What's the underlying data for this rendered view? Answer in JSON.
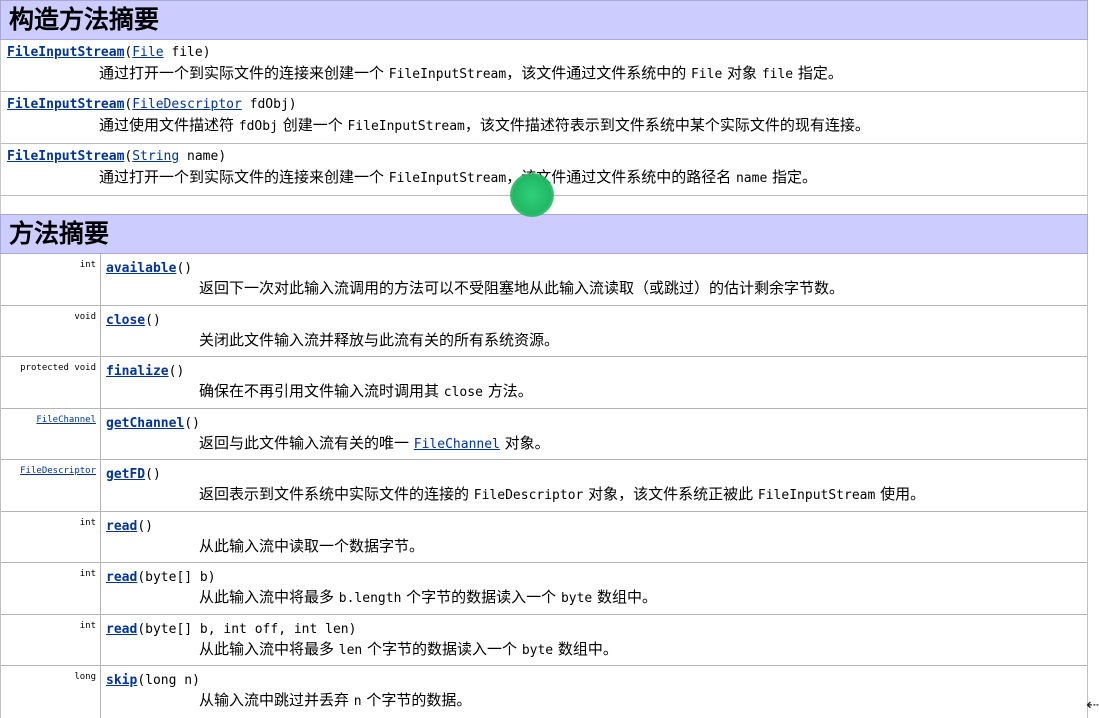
{
  "constructor_section": {
    "title": "构造方法摘要",
    "rows": [
      {
        "name": "FileInputStream",
        "param_type": "File",
        "param_name": "file",
        "desc": [
          {
            "t": "text",
            "v": "通过打开一个到实际文件的连接来创建一个 "
          },
          {
            "t": "mono",
            "v": "FileInputStream"
          },
          {
            "t": "text",
            "v": "，该文件通过文件系统中的 "
          },
          {
            "t": "mono",
            "v": "File"
          },
          {
            "t": "text",
            "v": " 对象 "
          },
          {
            "t": "mono",
            "v": "file"
          },
          {
            "t": "text",
            "v": " 指定。"
          }
        ]
      },
      {
        "name": "FileInputStream",
        "param_type": "FileDescriptor",
        "param_name": "fdObj",
        "desc": [
          {
            "t": "text",
            "v": "通过使用文件描述符 "
          },
          {
            "t": "mono",
            "v": "fdObj"
          },
          {
            "t": "text",
            "v": " 创建一个 "
          },
          {
            "t": "mono",
            "v": "FileInputStream"
          },
          {
            "t": "text",
            "v": "，该文件描述符表示到文件系统中某个实际文件的现有连接。"
          }
        ]
      },
      {
        "name": "FileInputStream",
        "param_type": "String",
        "param_name": "name",
        "desc": [
          {
            "t": "text",
            "v": "通过打开一个到实际文件的连接来创建一个 "
          },
          {
            "t": "mono",
            "v": "FileInputStream"
          },
          {
            "t": "text",
            "v": "，该文件通过文件系统中的路径名 "
          },
          {
            "t": "mono",
            "v": "name"
          },
          {
            "t": "text",
            "v": " 指定。"
          }
        ]
      }
    ]
  },
  "method_section": {
    "title": "方法摘要",
    "rows": [
      {
        "type": "int",
        "type_link": false,
        "name": "available",
        "params": "()",
        "desc": [
          {
            "t": "text",
            "v": "返回下一次对此输入流调用的方法可以不受阻塞地从此输入流读取（或跳过）的估计剩余字节数。"
          }
        ]
      },
      {
        "type": "void",
        "type_link": false,
        "name": "close",
        "params": "()",
        "desc": [
          {
            "t": "text",
            "v": "关闭此文件输入流并释放与此流有关的所有系统资源。"
          }
        ]
      },
      {
        "type": "protected  void",
        "type_link": false,
        "name": "finalize",
        "params": "()",
        "desc": [
          {
            "t": "text",
            "v": "确保在不再引用文件输入流时调用其 "
          },
          {
            "t": "mono",
            "v": "close"
          },
          {
            "t": "text",
            "v": " 方法。"
          }
        ]
      },
      {
        "type": "FileChannel",
        "type_link": true,
        "name": "getChannel",
        "params": "()",
        "desc": [
          {
            "t": "text",
            "v": "返回与此文件输入流有关的唯一 "
          },
          {
            "t": "link",
            "v": "FileChannel"
          },
          {
            "t": "text",
            "v": " 对象。"
          }
        ]
      },
      {
        "type": "FileDescriptor",
        "type_link": true,
        "name": "getFD",
        "params": "()",
        "desc": [
          {
            "t": "text",
            "v": "返回表示到文件系统中实际文件的连接的 "
          },
          {
            "t": "mono",
            "v": "FileDescriptor"
          },
          {
            "t": "text",
            "v": " 对象，该文件系统正被此 "
          },
          {
            "t": "mono",
            "v": "FileInputStream"
          },
          {
            "t": "text",
            "v": " 使用。"
          }
        ]
      },
      {
        "type": "int",
        "type_link": false,
        "name": "read",
        "params": "()",
        "desc": [
          {
            "t": "text",
            "v": "从此输入流中读取一个数据字节。"
          }
        ]
      },
      {
        "type": "int",
        "type_link": false,
        "name": "read",
        "params": "(byte[] b)",
        "desc": [
          {
            "t": "text",
            "v": "从此输入流中将最多 "
          },
          {
            "t": "mono",
            "v": "b.length"
          },
          {
            "t": "text",
            "v": " 个字节的数据读入一个 "
          },
          {
            "t": "mono",
            "v": "byte"
          },
          {
            "t": "text",
            "v": " 数组中。"
          }
        ]
      },
      {
        "type": "int",
        "type_link": false,
        "name": "read",
        "params": "(byte[] b, int off, int len)",
        "desc": [
          {
            "t": "text",
            "v": "从此输入流中将最多 "
          },
          {
            "t": "mono",
            "v": "len"
          },
          {
            "t": "text",
            "v": " 个字节的数据读入一个 "
          },
          {
            "t": "mono",
            "v": "byte"
          },
          {
            "t": "text",
            "v": " 数组中。"
          }
        ]
      },
      {
        "type": "long",
        "type_link": false,
        "name": "skip",
        "params": "(long n)",
        "desc": [
          {
            "t": "text",
            "v": "从输入流中跳过并丢弃 "
          },
          {
            "t": "mono",
            "v": "n"
          },
          {
            "t": "text",
            "v": " 个字节的数据。"
          }
        ]
      }
    ]
  },
  "overlay": {
    "cursor_color": "#22b864",
    "resize_glyph": "⇠"
  }
}
